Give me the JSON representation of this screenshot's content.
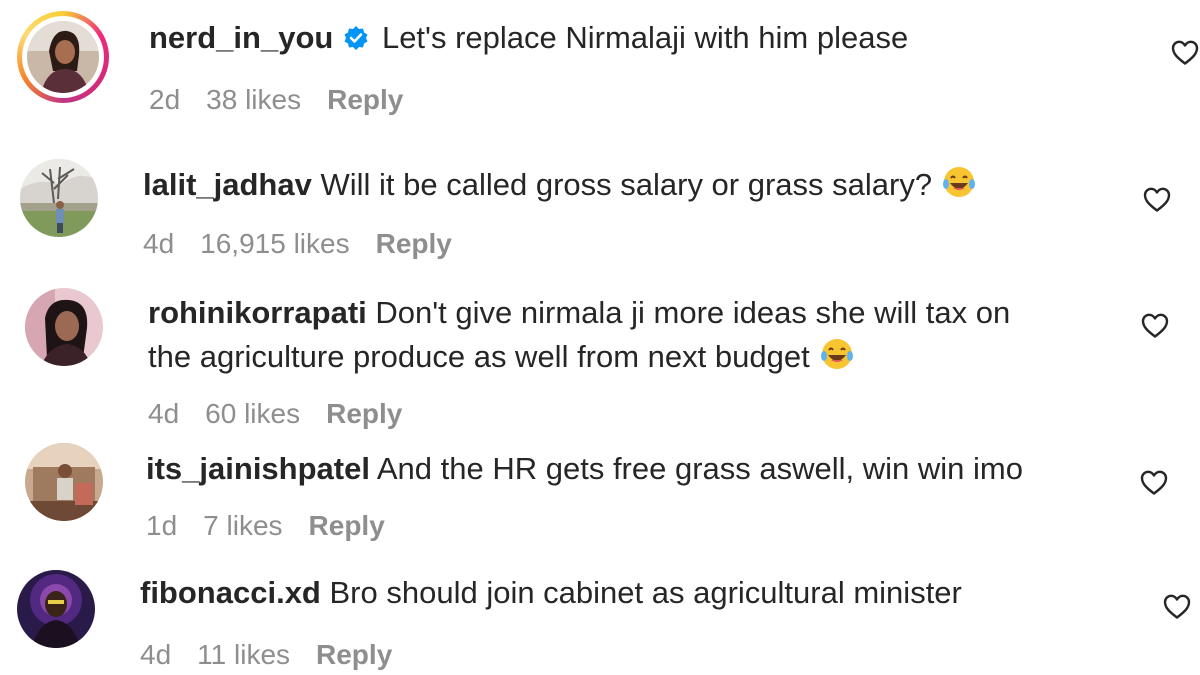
{
  "comments": [
    {
      "username": "nerd_in_you",
      "verified": true,
      "text": "Let's replace Nirmalaji with him please",
      "emoji": "",
      "time": "2d",
      "likes": "38 likes",
      "reply": "Reply"
    },
    {
      "username": "lalit_jadhav",
      "text": "Will it be called gross salary or grass salary?",
      "emoji": "laughing-tears-emoji",
      "time": "4d",
      "likes": "16,915 likes",
      "reply": "Reply"
    },
    {
      "username": "rohinikorrapati",
      "text_line1": "Don't give nirmala ji more ideas she will tax on",
      "text_line2": "the agriculture produce as well from next budget",
      "emoji": "laughing-tears-emoji",
      "time": "4d",
      "likes": "60 likes",
      "reply": "Reply"
    },
    {
      "username": "its_jainishpatel",
      "text": "And the HR gets free grass aswell, win win imo",
      "time": "1d",
      "likes": "7 likes",
      "reply": "Reply"
    },
    {
      "username": "fibonacci.xd",
      "text": "Bro should join cabinet as agricultural minister",
      "time": "4d",
      "likes": "11 likes",
      "reply": "Reply"
    }
  ],
  "colors": {
    "text": "#262626",
    "muted": "#8e8e8e",
    "verified": "#0095f6"
  },
  "icons": {
    "like": "heart-outline-icon",
    "verified": "verified-badge-icon"
  }
}
